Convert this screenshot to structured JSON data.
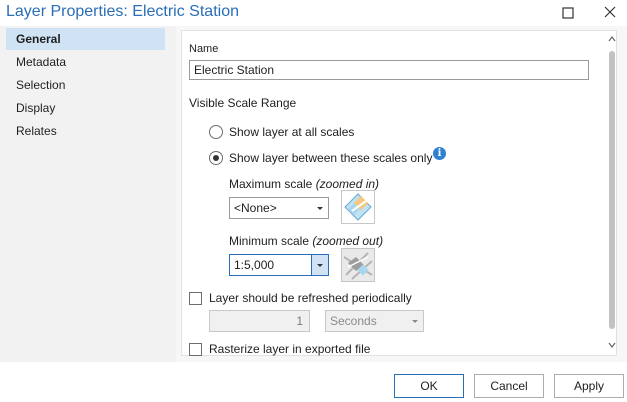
{
  "window": {
    "title": "Layer Properties: Electric Station"
  },
  "sidebar": {
    "items": [
      {
        "label": "General",
        "selected": true
      },
      {
        "label": "Metadata"
      },
      {
        "label": "Selection"
      },
      {
        "label": "Display"
      },
      {
        "label": "Relates"
      }
    ]
  },
  "general": {
    "name_label": "Name",
    "name_value": "Electric Station",
    "visible_scale_range_label": "Visible Scale Range",
    "show_all_scales_label": "Show layer at all scales",
    "show_between_scales_label": "Show layer between these scales only",
    "selected_scale_option": "between",
    "max_scale_label": "Maximum scale ",
    "max_scale_hint": "(zoomed in)",
    "max_scale_value": "<None>",
    "min_scale_label": "Minimum scale ",
    "min_scale_hint": "(zoomed out)",
    "min_scale_value": "1:5,000",
    "refresh_label": "Layer should be refreshed periodically",
    "refresh_checked": false,
    "refresh_interval_value": "1",
    "refresh_unit_value": "Seconds",
    "rasterize_label": "Rasterize layer in exported file",
    "rasterize_checked": false
  },
  "icons": {
    "info": "info-icon",
    "max_scale": "zoom-in-map-icon",
    "min_scale": "zoom-out-map-icon"
  },
  "buttons": {
    "ok": "OK",
    "cancel": "Cancel",
    "apply": "Apply"
  },
  "colors": {
    "title": "#2a6eb7",
    "selected_nav": "#cfe3f5",
    "info_icon": "#2f80d1"
  }
}
